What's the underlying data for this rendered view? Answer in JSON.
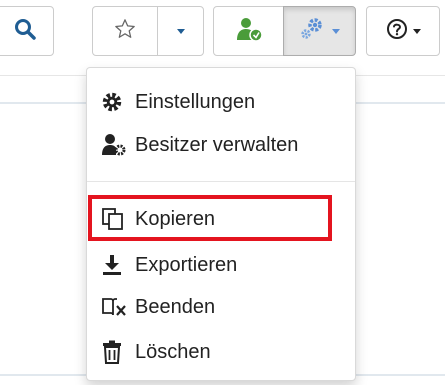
{
  "toolbar": {
    "buttons": [
      {
        "name": "search",
        "icon": "search-icon"
      },
      {
        "name": "bookmark",
        "icon": "star-outline-icon"
      },
      {
        "name": "bookmark-dropdown",
        "icon": "caret-down-icon"
      },
      {
        "name": "owner",
        "icon": "user-add-icon"
      },
      {
        "name": "settings",
        "icon": "gears-icon",
        "active": true
      },
      {
        "name": "help",
        "icon": "question-circle-icon"
      }
    ]
  },
  "menu": {
    "items": [
      {
        "label": "Einstellungen",
        "icon": "cog-icon"
      },
      {
        "label": "Besitzer verwalten",
        "icon": "user-cog-icon"
      },
      {
        "label": "Kopieren",
        "icon": "copy-icon",
        "highlighted": true
      },
      {
        "label": "Exportieren",
        "icon": "download-icon"
      },
      {
        "label": "Beenden",
        "icon": "book-close-icon"
      },
      {
        "label": "Löschen",
        "icon": "trash-icon"
      }
    ]
  },
  "colors": {
    "accent_blue": "#1f5d93",
    "owner_green": "#4a9c3a",
    "gears_blue": "#5b8fd6",
    "highlight_red": "#e4141f"
  }
}
